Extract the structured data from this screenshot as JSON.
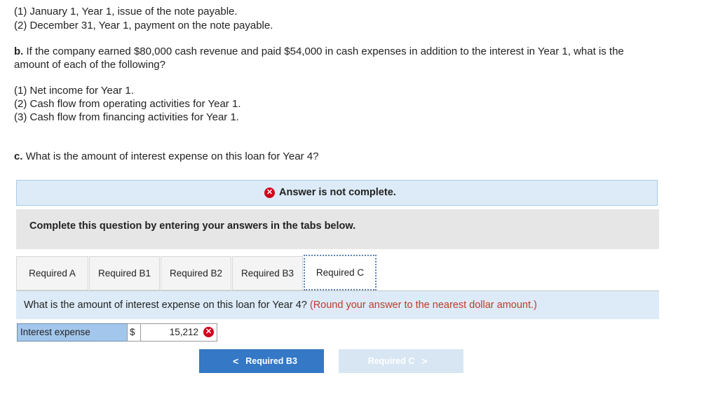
{
  "question": {
    "a_line1": "(1) January 1, Year 1, issue of the note payable.",
    "a_line2": "(2) December 31, Year 1, payment on the note payable.",
    "b_prefix": "b.",
    "b_text": "If the company earned $80,000 cash revenue and paid $54,000 in cash expenses in addition to the interest in Year 1, what is the",
    "b_text2": "amount of each of the following?",
    "b_item1": "(1) Net income for Year 1.",
    "b_item2": "(2) Cash flow from operating activities for Year 1.",
    "b_item3": "(3) Cash flow from financing activities for Year 1.",
    "c_prefix": "c.",
    "c_text": "What is the amount of interest expense on this loan for Year 4?"
  },
  "status": {
    "message": "Answer is not complete.",
    "icon": "x-circle-icon",
    "color": "#d0021b"
  },
  "instructions": "Complete this question by entering your answers in the tabs below.",
  "tabs": [
    {
      "label": "Required A"
    },
    {
      "label": "Required B1"
    },
    {
      "label": "Required B2"
    },
    {
      "label": "Required B3"
    },
    {
      "label": "Required C",
      "active": true
    }
  ],
  "panel": {
    "question": "What is the amount of interest expense on this loan for Year 4?",
    "hint": "(Round your answer to the nearest dollar amount.)"
  },
  "answer": {
    "label": "Interest expense",
    "currency": "$",
    "value": "15,212",
    "status_icon": "x-circle-icon"
  },
  "nav": {
    "prev_label": "Required B3",
    "next_label": "Required C"
  }
}
